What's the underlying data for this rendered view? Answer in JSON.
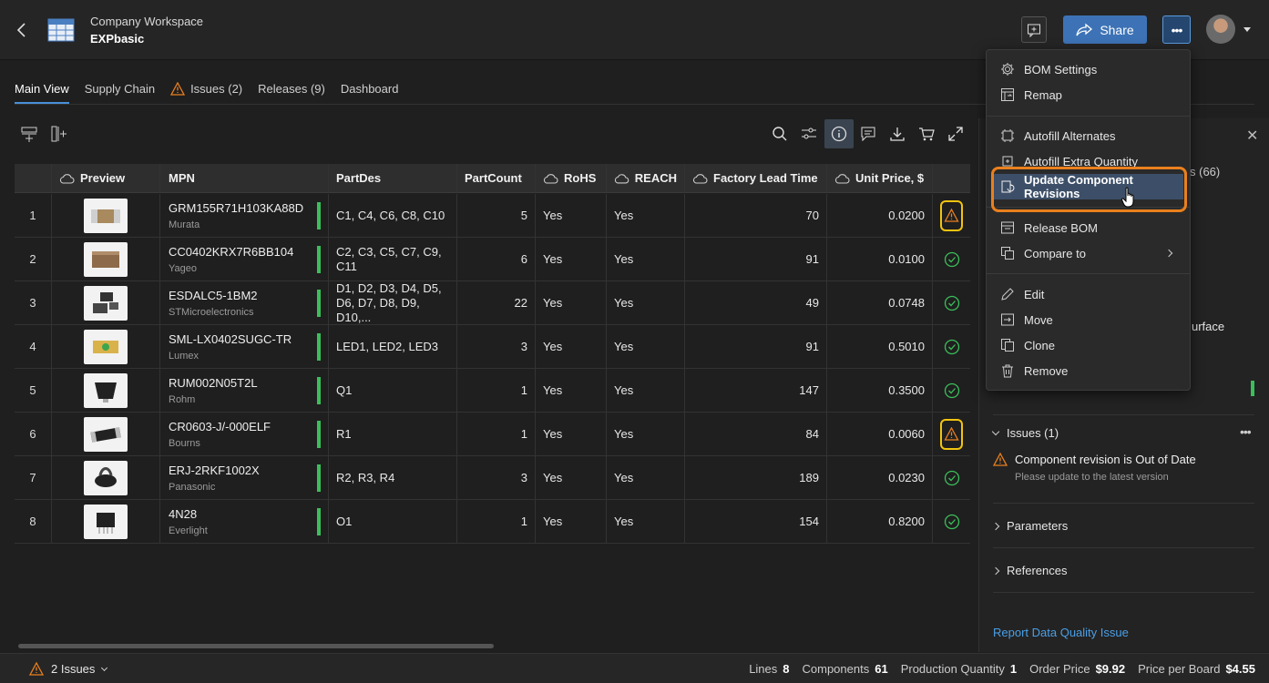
{
  "header": {
    "workspace": "Company Workspace",
    "project": "EXPbasic",
    "share_label": "Share",
    "more_label": "•••"
  },
  "tabs": [
    {
      "label": "Main View",
      "active": true
    },
    {
      "label": "Supply Chain"
    },
    {
      "label": "Issues (2)",
      "icon": "warning-icon"
    },
    {
      "label": "Releases (9)"
    },
    {
      "label": "Dashboard"
    }
  ],
  "table": {
    "columns": {
      "preview": "Preview",
      "mpn": "MPN",
      "partdes": "PartDes",
      "partcount": "PartCount",
      "rohs": "RoHS",
      "reach": "REACH",
      "lead": "Factory Lead Time",
      "price": "Unit Price, $"
    },
    "rows": [
      {
        "num": "1",
        "mpn": "GRM155R71H103KA88D",
        "mfr": "Murata",
        "des": "C1, C4, C6, C8, C10",
        "count": "5",
        "rohs": "Yes",
        "reach": "Yes",
        "lead": "70",
        "price": "0.0200",
        "status": "warning"
      },
      {
        "num": "2",
        "mpn": "CC0402KRX7R6BB104",
        "mfr": "Yageo",
        "des": "C2, C3, C5, C7, C9, C11",
        "count": "6",
        "rohs": "Yes",
        "reach": "Yes",
        "lead": "91",
        "price": "0.0100",
        "status": "ok"
      },
      {
        "num": "3",
        "mpn": "ESDALC5-1BM2",
        "mfr": "STMicroelectronics",
        "des": "D1, D2, D3, D4, D5, D6, D7, D8, D9, D10,...",
        "count": "22",
        "rohs": "Yes",
        "reach": "Yes",
        "lead": "49",
        "price": "0.0748",
        "status": "ok"
      },
      {
        "num": "4",
        "mpn": "SML-LX0402SUGC-TR",
        "mfr": "Lumex",
        "des": "LED1, LED2, LED3",
        "count": "3",
        "rohs": "Yes",
        "reach": "Yes",
        "lead": "91",
        "price": "0.5010",
        "status": "ok"
      },
      {
        "num": "5",
        "mpn": "RUM002N05T2L",
        "mfr": "Rohm",
        "des": "Q1",
        "count": "1",
        "rohs": "Yes",
        "reach": "Yes",
        "lead": "147",
        "price": "0.3500",
        "status": "ok"
      },
      {
        "num": "6",
        "mpn": "CR0603-J/-000ELF",
        "mfr": "Bourns",
        "des": "R1",
        "count": "1",
        "rohs": "Yes",
        "reach": "Yes",
        "lead": "84",
        "price": "0.0060",
        "status": "warning"
      },
      {
        "num": "7",
        "mpn": "ERJ-2RKF1002X",
        "mfr": "Panasonic",
        "des": "R2, R3, R4",
        "count": "3",
        "rohs": "Yes",
        "reach": "Yes",
        "lead": "189",
        "price": "0.0230",
        "status": "ok"
      },
      {
        "num": "8",
        "mpn": "4N28",
        "mfr": "Everlight",
        "des": "O1",
        "count": "1",
        "rohs": "Yes",
        "reach": "Yes",
        "lead": "154",
        "price": "0.8200",
        "status": "ok"
      }
    ]
  },
  "menu": {
    "items": [
      {
        "label": "BOM Settings",
        "icon": "gear-icon"
      },
      {
        "label": "Remap",
        "icon": "remap-icon"
      },
      {
        "label": "Autofill Alternates",
        "icon": "autofill-icon"
      },
      {
        "label": "Autofill Extra Quantity",
        "icon": "autofill-qty-icon"
      },
      {
        "label": "Update Component Revisions",
        "icon": "update-revisions-icon",
        "highlighted": true
      },
      {
        "label": "Release BOM",
        "icon": "release-icon"
      },
      {
        "label": "Compare to",
        "icon": "compare-icon"
      },
      {
        "label": "Edit",
        "icon": "pencil-icon"
      },
      {
        "label": "Move",
        "icon": "move-icon"
      },
      {
        "label": "Clone",
        "icon": "clone-icon"
      },
      {
        "label": "Remove",
        "icon": "trash-icon"
      }
    ]
  },
  "panel": {
    "partial_count": "s (66)",
    "partial_text": "urface",
    "issues_title": "Issues (1)",
    "issue_title": "Component revision is Out of Date",
    "issue_desc": "Please update to the latest version",
    "parameters": "Parameters",
    "references": "References",
    "report_link": "Report Data Quality Issue"
  },
  "status": {
    "issues": "2 Issues",
    "lines_label": "Lines",
    "lines": "8",
    "components_label": "Components",
    "components": "61",
    "prodqty_label": "Production Quantity",
    "prodqty": "1",
    "order_label": "Order Price",
    "order": "$9.92",
    "board_label": "Price per Board",
    "board": "$4.55"
  },
  "colors": {
    "accent": "#3d73b6",
    "ok": "#3bbf5a",
    "warning": "#e9801e",
    "highlight_ring": "#e9801e",
    "warn_frame": "#f1c40f"
  }
}
